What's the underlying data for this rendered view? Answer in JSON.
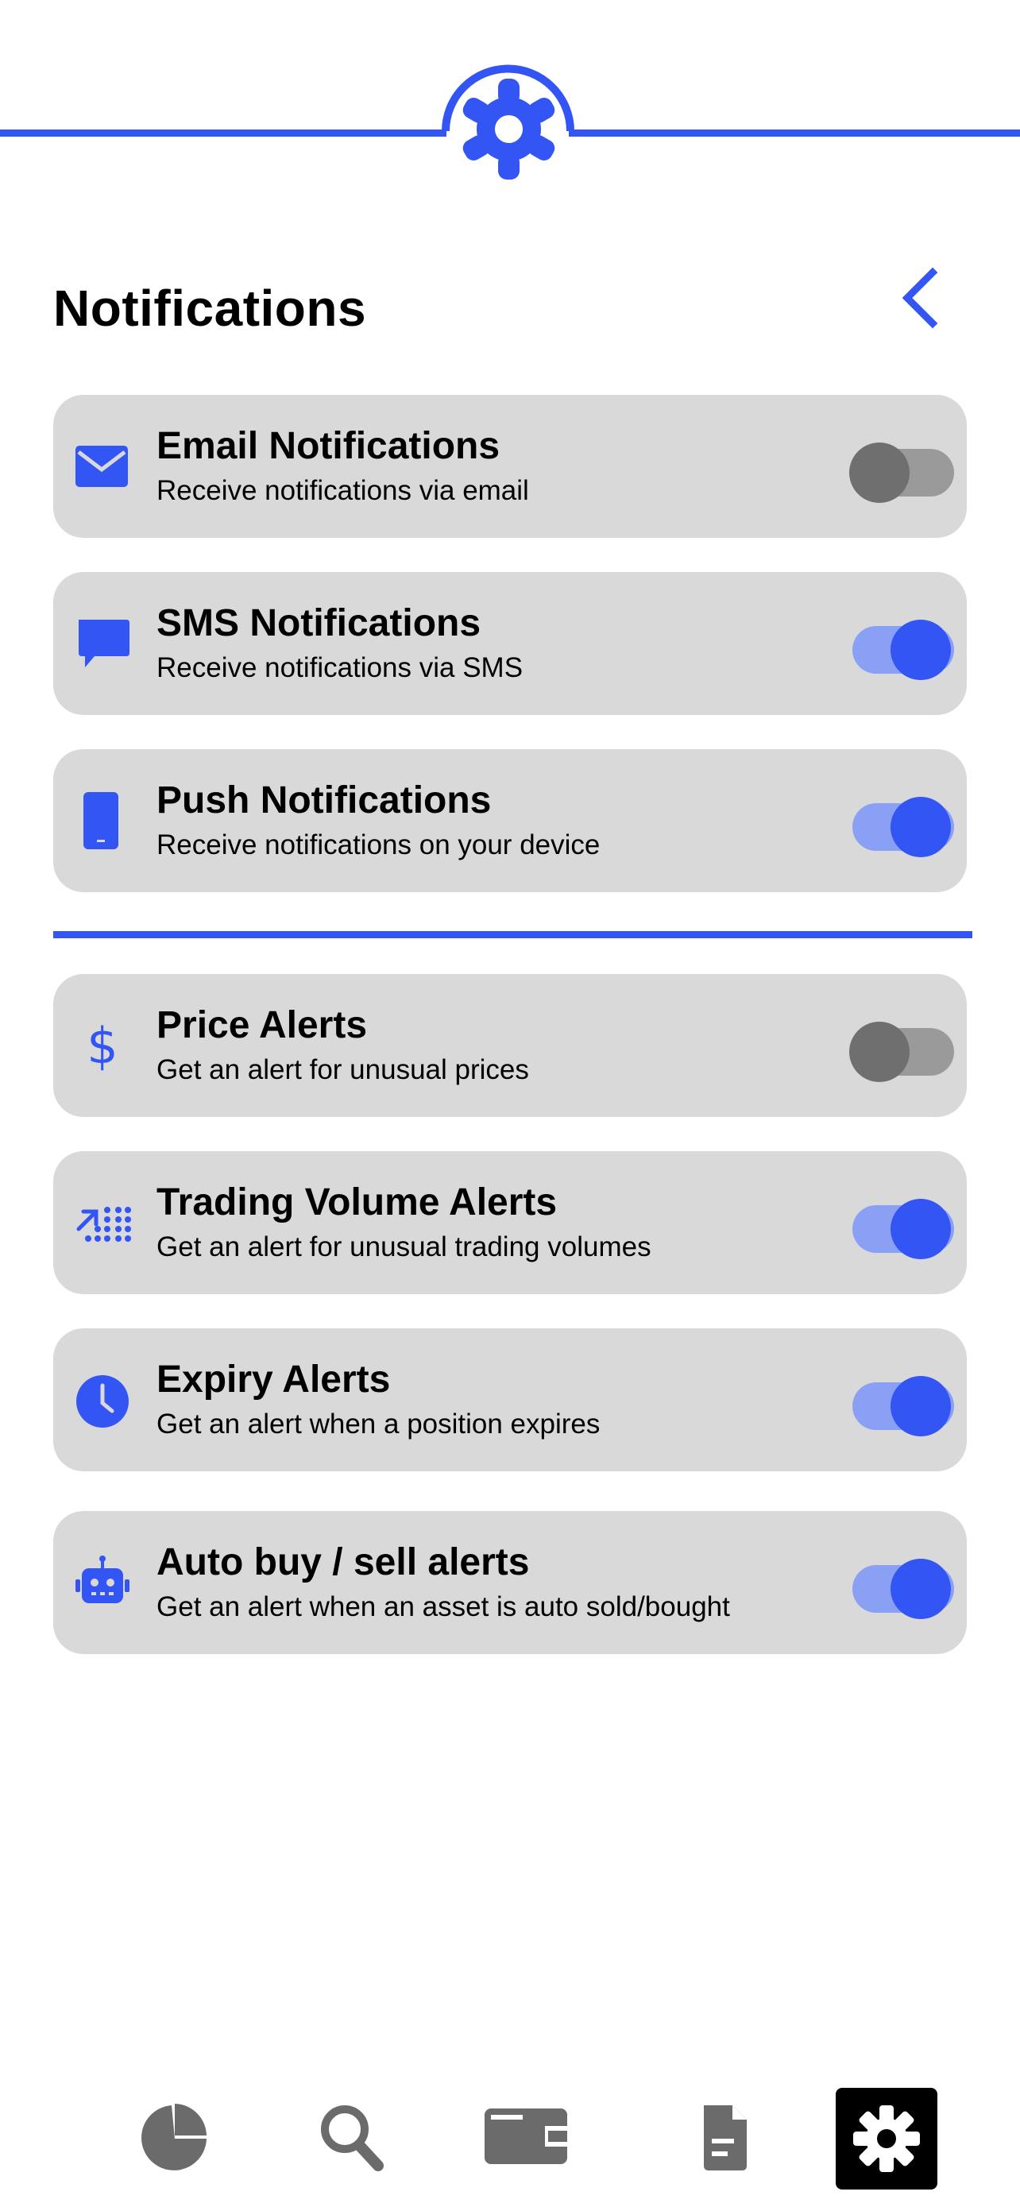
{
  "header": {
    "title": "Notifications",
    "logo_icon": "gear-icon",
    "back_icon": "chevron-left-icon",
    "accent_color": "#3355f4"
  },
  "notification_settings": [
    {
      "title": "Email Notifications",
      "description": "Receive notifications via email",
      "icon": "envelope-icon",
      "enabled": false
    },
    {
      "title": "SMS Notifications",
      "description": "Receive notifications via SMS",
      "icon": "chat-bubble-icon",
      "enabled": true
    },
    {
      "title": "Push Notifications",
      "description": "Receive notifications on your device",
      "icon": "mobile-phone-icon",
      "enabled": true
    }
  ],
  "alert_settings": [
    {
      "title": "Price Alerts",
      "description": "Get an alert for unusual prices",
      "icon": "dollar-icon",
      "enabled": false
    },
    {
      "title": "Trading Volume Alerts",
      "description": "Get an alert for unusual trading volumes",
      "icon": "trending-volume-icon",
      "enabled": true
    },
    {
      "title": "Expiry Alerts",
      "description": "Get an alert when a position expires",
      "icon": "clock-icon",
      "enabled": true
    },
    {
      "title": "Auto buy / sell alerts",
      "description": "Get an alert when an asset is auto sold/bought",
      "icon": "robot-icon",
      "enabled": true
    }
  ],
  "bottom_nav": [
    {
      "icon": "pie-chart-icon",
      "active": false
    },
    {
      "icon": "search-icon",
      "active": false
    },
    {
      "icon": "wallet-icon",
      "active": false
    },
    {
      "icon": "document-icon",
      "active": false
    },
    {
      "icon": "gear-icon",
      "active": true
    }
  ],
  "colors": {
    "toggle_on_track": "#8aa0f5",
    "toggle_on_knob": "#3355f4",
    "toggle_off_track": "#9a9a9a",
    "toggle_off_knob": "#6f6f6f",
    "card_background": "#d9d9d9",
    "nav_icon": "#6b6b6b"
  }
}
